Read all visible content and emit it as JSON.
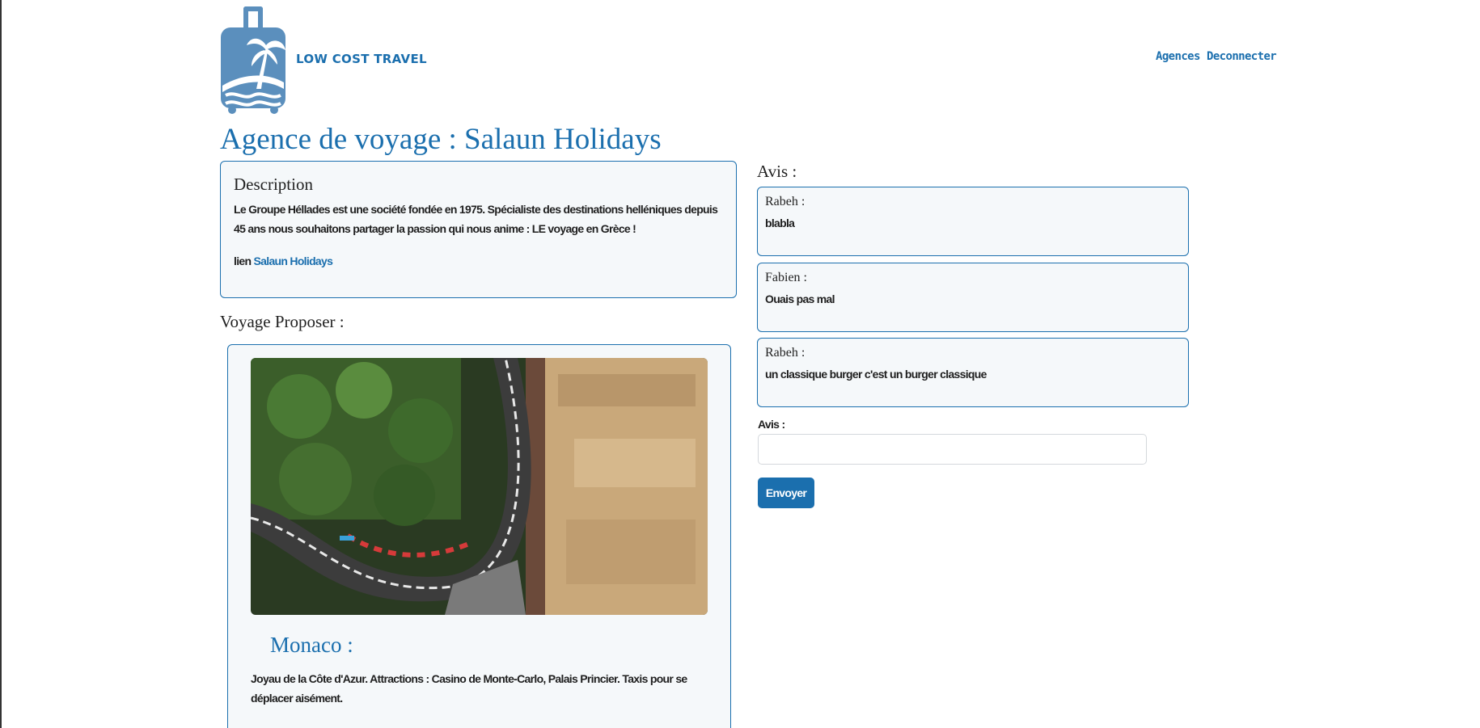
{
  "header": {
    "brand": "LOW COST TRAVEL",
    "nav": {
      "agences": "Agences",
      "deconnecter": "Deconnecter"
    }
  },
  "page_title": "Agence de voyage : Salaun Holidays",
  "description": {
    "heading": "Description",
    "text": "Le Groupe Héllades est une société fondée en 1975. Spécialiste des destinations helléniques depuis 45 ans nous souhaitons partager la passion qui nous anime : LE voyage en Grèce !",
    "link_prefix": "lien",
    "link_text": "Salaun Holidays"
  },
  "voyage": {
    "heading": "Voyage Proposer :",
    "trip": {
      "title": "Monaco :",
      "description": "Joyau de la Côte d'Azur. Attractions : Casino de Monte-Carlo, Palais Princier. Taxis pour se déplacer aisément."
    }
  },
  "avis": {
    "heading": "Avis :",
    "reviews": [
      {
        "author": "Rabeh :",
        "text": "blabla"
      },
      {
        "author": "Fabien :",
        "text": "Ouais pas mal"
      },
      {
        "author": "Rabeh :",
        "text": "un classique burger c'est un burger classique"
      }
    ],
    "form": {
      "label": "Avis :",
      "value": "",
      "submit_label": "Envoyer"
    }
  },
  "colors": {
    "accent": "#1b6fae",
    "box_bg": "#f5f8fa",
    "logo": "#5b8fbd"
  },
  "icons": {
    "logo": "suitcase-palm-logo-icon"
  }
}
